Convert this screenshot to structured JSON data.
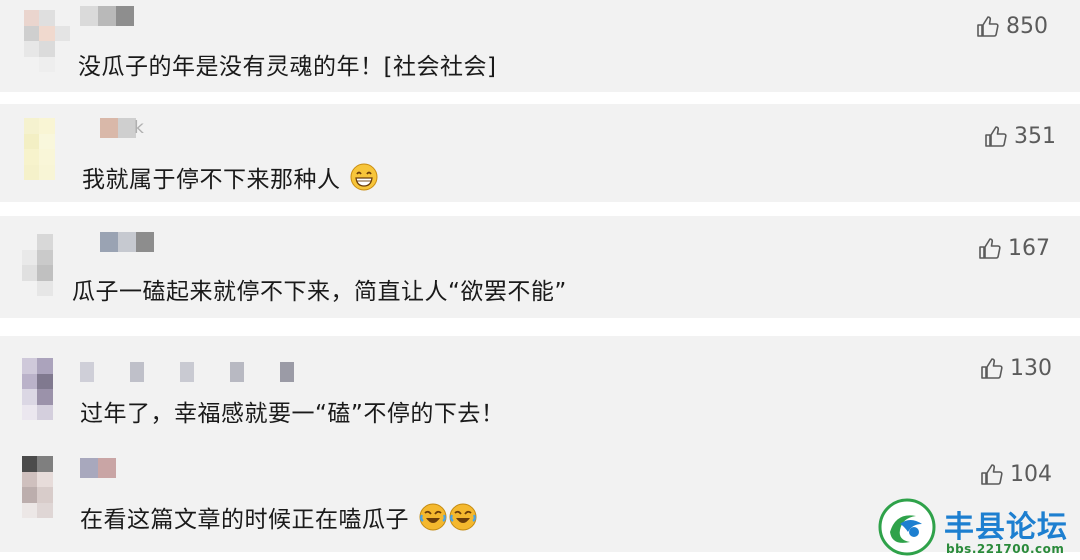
{
  "comments": [
    {
      "text": "没瓜子的年是没有灵魂的年！[社会社会]",
      "likes": "850",
      "name_fragment": "",
      "emoji": []
    },
    {
      "text": "我就属于停不下来那种人",
      "likes": "351",
      "name_fragment": "k",
      "emoji": [
        "grin"
      ]
    },
    {
      "text": "瓜子一磕起来就停不下来，简直让人“欲罢不能”",
      "likes": "167",
      "name_fragment": "",
      "emoji": []
    },
    {
      "text": "过年了，幸福感就要一“磕”不停的下去！",
      "likes": "130",
      "name_fragment": "",
      "emoji": []
    },
    {
      "text": "在看这篇文章的时候正在嗑瓜子",
      "likes": "104",
      "name_fragment": "",
      "emoji": [
        "laugh-cry",
        "laugh-cry"
      ]
    }
  ],
  "icons": {
    "like": "thumbs-up-icon"
  },
  "watermark": {
    "title": "丰县论坛",
    "url": "bbs.221700.com"
  },
  "colors": {
    "card_bg": "#f2f2f2",
    "text": "#1a1a1a",
    "like_text": "#5b5b5b",
    "watermark_blue": "#1d7fd0",
    "watermark_green": "#2a8a3a"
  }
}
